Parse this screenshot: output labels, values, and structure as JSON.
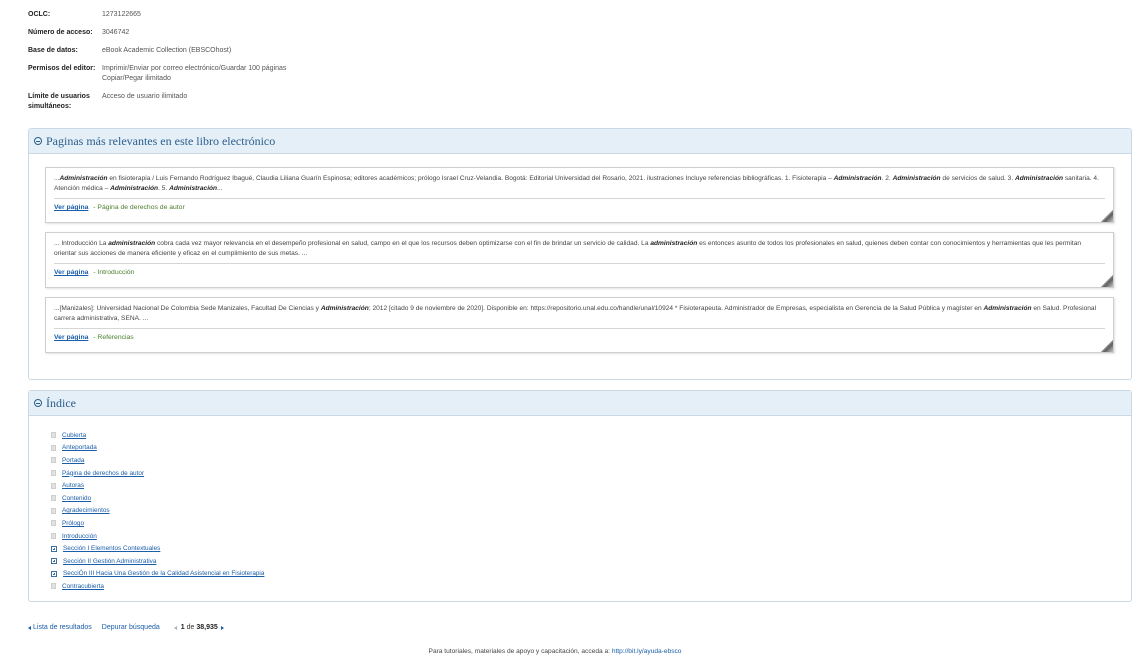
{
  "record": {
    "oclc_label": "OCLC:",
    "oclc_value": "1273122665",
    "access_label": "Número de acceso:",
    "access_value": "3046742",
    "db_label": "Base de datos:",
    "db_value": "eBook Academic Collection (EBSCOhost)",
    "permissions_label": "Permisos del editor:",
    "permissions_line1": "Imprimir/Enviar por correo electrónico/Guardar 100 páginas",
    "permissions_line2": "Copiar/Pegar ilimitado",
    "users_label_1": "Límite de usuarios",
    "users_label_2": "simultáneos:",
    "users_value": "Acceso de usuario ilimitado"
  },
  "relevant": {
    "title": "Paginas más relevantes en este libro electrónico",
    "view_page_label": "Ver página",
    "pages": [
      {
        "segments": [
          {
            "t": "...",
            "b": false
          },
          {
            "t": "Administración",
            "b": true
          },
          {
            "t": " en fisioterapia / Luis Fernando Rodríguez Ibagué, Claudia Liliana Guarín Espinosa; editores académicos; prólogo Israel Cruz-Velandia. Bogotá: Editorial Universidad del Rosario, 2021. ilustraciones Incluye referencias bibliográficas. 1. Fisioterapia – ",
            "b": false
          },
          {
            "t": "Administración",
            "b": true
          },
          {
            "t": ". 2. ",
            "b": false
          },
          {
            "t": "Administración",
            "b": true
          },
          {
            "t": " de servicios de salud. 3. ",
            "b": false
          },
          {
            "t": "Administración",
            "b": true
          },
          {
            "t": " sanitaria. 4. Atención médica – ",
            "b": false
          },
          {
            "t": "Administración",
            "b": true
          },
          {
            "t": ". 5. ",
            "b": false
          },
          {
            "t": "Administración",
            "b": true
          },
          {
            "t": "...",
            "b": false
          }
        ],
        "type": "- Página de derechos de autor"
      },
      {
        "segments": [
          {
            "t": "... Introducción La ",
            "b": false
          },
          {
            "t": "administración",
            "b": true
          },
          {
            "t": " cobra cada vez mayor relevancia en el desempeño profesional en salud, campo en el que los recursos deben optimizarse con el fin de brindar un servicio de calidad. La ",
            "b": false
          },
          {
            "t": "administración",
            "b": true
          },
          {
            "t": " es entonces asunto de todos los profesionales en salud, quienes deben contar con conocimientos y herramientas que les permitan orientar sus acciones de manera eficiente y eficaz en el cumplimiento de sus metas. ...",
            "b": false
          }
        ],
        "type": "- Introducción"
      },
      {
        "segments": [
          {
            "t": "...[Manizales]: Universidad Nacional De Colombia Sede Manizales, Facultad De Ciencias y ",
            "b": false
          },
          {
            "t": "Administración",
            "b": true
          },
          {
            "t": "; 2012 [citado 9 de noviembre de 2020]. Disponible en: https://repositorio.unal.edu.co/handle/unal/10924 *    Fisioterapeuta. Administrador de Empresas, especialista en Gerencia de la Salud Pública y magíster en ",
            "b": false
          },
          {
            "t": "Administración",
            "b": true
          },
          {
            "t": " en Salud. Profesional carrera administrativa, SENA. ...",
            "b": false
          }
        ],
        "type": "- Referencias"
      }
    ]
  },
  "index": {
    "title": "Índice",
    "items": [
      {
        "label": "Cubierta",
        "icon": "page-icon"
      },
      {
        "label": "Anteportada",
        "icon": "page-icon"
      },
      {
        "label": "Portada",
        "icon": "page-icon"
      },
      {
        "label": "Página de derechos de autor",
        "icon": "page-icon"
      },
      {
        "label": "Autoras",
        "icon": "page-icon"
      },
      {
        "label": "Contenido",
        "icon": "page-icon"
      },
      {
        "label": "Agradecimientos",
        "icon": "page-icon"
      },
      {
        "label": "Prólogo",
        "icon": "page-icon"
      },
      {
        "label": "Introducción",
        "icon": "page-icon"
      },
      {
        "label": "Sección I Elementos Contextuales",
        "icon": "expand-plus-icon"
      },
      {
        "label": "Sección II Gestión Administrativa",
        "icon": "expand-plus-icon"
      },
      {
        "label": "SecciÓn III Hacia Una Gestión de la Calidad Asistencial en Fisioterapia",
        "icon": "expand-plus-icon"
      },
      {
        "label": "Contracubierta",
        "icon": "page-icon"
      }
    ]
  },
  "nav": {
    "results_list": "Lista de resultados",
    "refine_search": "Depurar búsqueda",
    "current": "1",
    "of_text": " de ",
    "total": "38,935"
  },
  "footer": {
    "text": "Para tutoriales, materiales de apoyo y capacitación, acceda a: ",
    "link": "http://bit.ly/ayuda-ebsco"
  }
}
